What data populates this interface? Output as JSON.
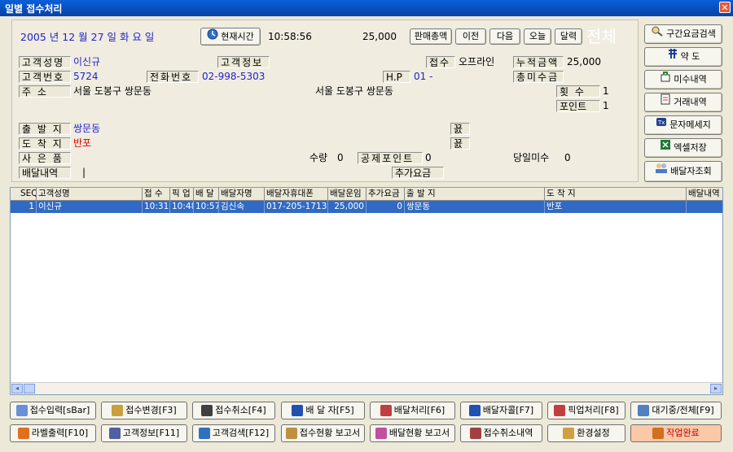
{
  "window": {
    "title": "일별 접수처리",
    "close": "✕"
  },
  "top": {
    "date": "2005 년   12 월   27 일  화 요 일",
    "now_button": "현재시간",
    "time": "10:58:56",
    "amount": "25,000",
    "nav": [
      "판매총액",
      "이전",
      "다음",
      "오늘",
      "달력"
    ],
    "all_label": "전체"
  },
  "customer": {
    "name_label": "고객성명",
    "name": "이신규",
    "info_label": "고객정보",
    "recv_label": "접수",
    "recv_type": "오프라인",
    "total_label": "누적금액",
    "total": "25,000",
    "id_label": "고객번호",
    "id": "5724",
    "phone_label": "전화번호",
    "phone": "02-998-5303",
    "hp_label": "H.P",
    "hp": "01 -",
    "unpaid_label": "총미수금",
    "addr_label": "주     소",
    "addr": "서울 도봉구 쌍문동",
    "addr2": "서울 도봉구 쌍문동",
    "count_label": "횟  수",
    "count": "1",
    "point_label": "포인트",
    "point": "1"
  },
  "order": {
    "from_label": "출 발 지",
    "from": "쌍문동",
    "to_label": "도 착 지",
    "to": "반포",
    "item_label": "사 은 품",
    "qty_label": "수량",
    "qty": "0",
    "deduct_label": "공제포인트",
    "deduct": "0",
    "today_unpaid_label": "당일미수",
    "today_unpaid": "0",
    "delivery_label": "배달내역",
    "delivery_value": "|",
    "extra_label": "추가요금",
    "hotkey1": "꾨",
    "hotkey2": "꾨"
  },
  "side_buttons": [
    "구간요금검색",
    "약 도",
    "미수내역",
    "거래내역",
    "문자메세지",
    "엑셀저장",
    "배달자조회"
  ],
  "grid": {
    "headers": [
      "SEQ",
      "고객성명",
      "접 수",
      "픽 업",
      "배 달",
      "배달자명",
      "배달자휴대폰",
      "배달운임",
      "추가요금",
      "출 발 지",
      "도 착 지",
      "배달내역"
    ],
    "rows": [
      [
        "1",
        "이신규",
        "10:31",
        "10:48",
        "10:57",
        "김신속",
        "017-205-1713",
        "25,000",
        "0",
        "쌍문동",
        "반포",
        ""
      ]
    ],
    "row_marker": "▶"
  },
  "bottom_buttons": [
    [
      "접수입력[sBar]",
      "접수변경[F3]",
      "접수취소[F4]",
      "배 달 자[F5]",
      "배달처리[F6]",
      "배달자콜[F7]",
      "픽업처리[F8]",
      "대기중/전체[F9]"
    ],
    [
      "라벨출력[F10]",
      "고객정보[F11]",
      "고객검색[F12]",
      "접수현황 보고서",
      "배달현황 보고서",
      "접수취소내역",
      "환경설정",
      "작업완료"
    ]
  ],
  "colors": {
    "title_bg": "#0a5fd8",
    "selected_row": "#316ac5",
    "blue_text": "#2222cc",
    "red_text": "#e00000",
    "finish_button": "#fbc8a8"
  },
  "icons": {
    "now": "clock-icon",
    "close": "close-icon",
    "scroll_left": "◂",
    "scroll_right": "▸"
  }
}
